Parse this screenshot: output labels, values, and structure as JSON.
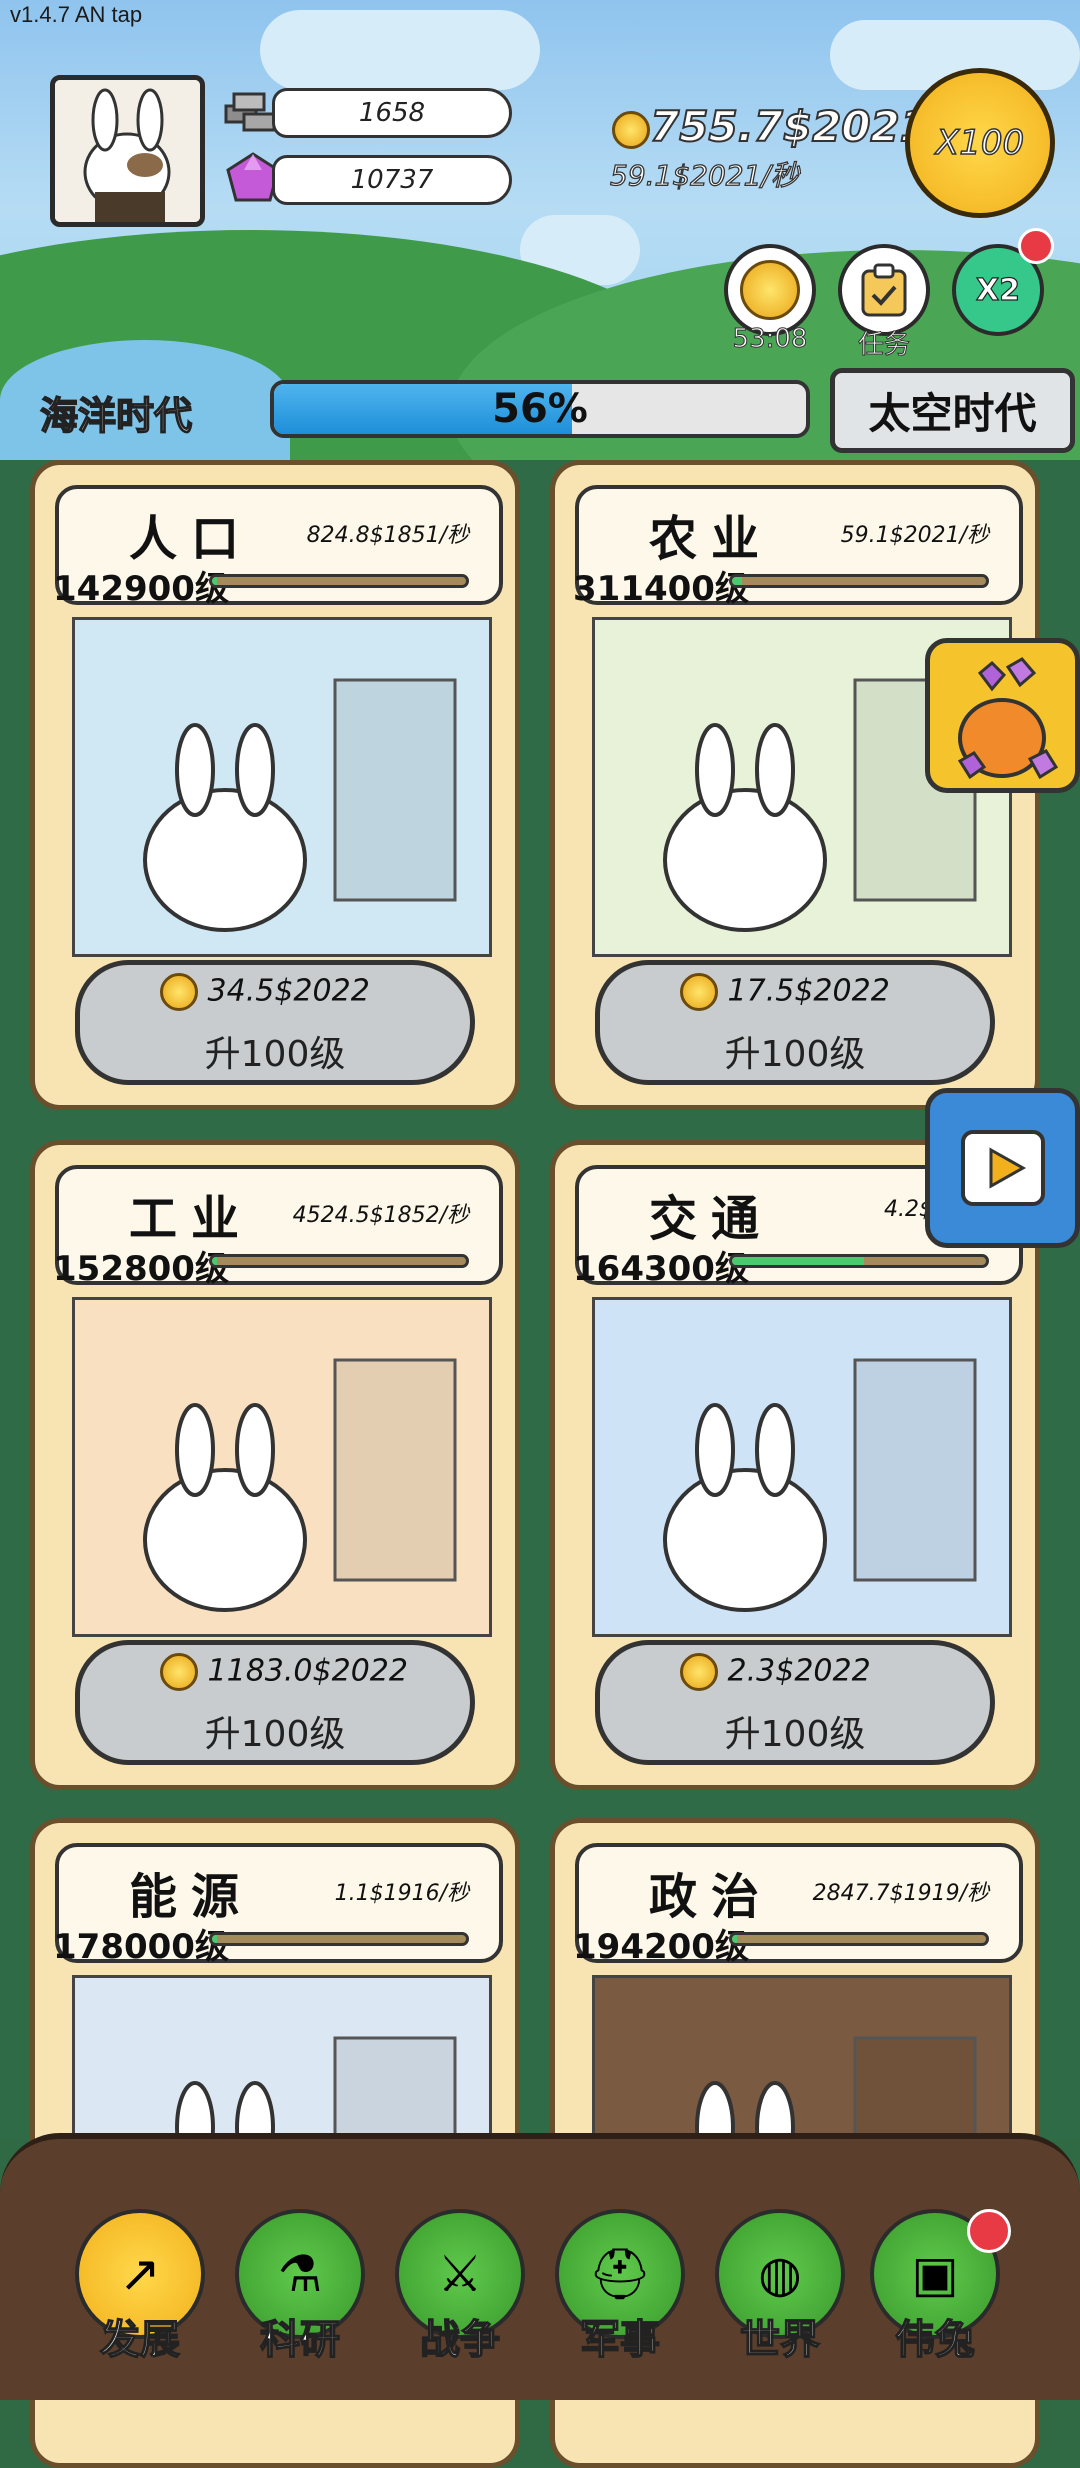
{
  "version": "v1.4.7 AN tap",
  "resources": {
    "iron": "1658",
    "gems": "10737"
  },
  "gold": {
    "amount": "755.7$2021",
    "rate": "59.1$2021/秒"
  },
  "multiplier_button": "X100",
  "buttons": {
    "timer": "53:08",
    "tasks": "任务",
    "double": "X2"
  },
  "age": {
    "current": "海洋时代",
    "progress_text": "56%",
    "progress_value": 0.56,
    "next": "太空时代"
  },
  "cards": [
    {
      "title": "人口",
      "rate": "824.8$1851/秒",
      "level": "142900级",
      "bar": 0.02,
      "cost": "34.5$2022",
      "upgrade": "升100级"
    },
    {
      "title": "农业",
      "rate": "59.1$2021/秒",
      "level": "311400级",
      "bar": 0.04,
      "cost": "17.5$2022",
      "upgrade": "升100级"
    },
    {
      "title": "工业",
      "rate": "4524.5$1852/秒",
      "level": "152800级",
      "bar": 0.02,
      "cost": "1183.0$2022",
      "upgrade": "升100级"
    },
    {
      "title": "交通",
      "rate": "4.2$1853",
      "level": "164300级",
      "bar": 0.52,
      "cost": "2.3$2022",
      "upgrade": "升100级"
    },
    {
      "title": "能源",
      "rate": "1.1$1916/秒",
      "level": "178000级",
      "bar": 0.02,
      "cost": "",
      "upgrade": ""
    },
    {
      "title": "政治",
      "rate": "2847.7$1919/秒",
      "level": "194200级",
      "bar": 0.02,
      "cost": "",
      "upgrade": ""
    }
  ],
  "nav": [
    "发展",
    "科研",
    "战争",
    "军事",
    "世界",
    "伟兔"
  ],
  "colors": {
    "accent_gold": "#f2b01c",
    "nav_green": "#3a9a2d",
    "bar_green": "#4ec86e"
  }
}
